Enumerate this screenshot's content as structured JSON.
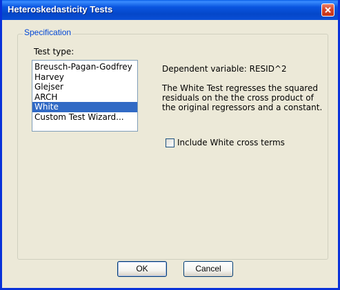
{
  "window": {
    "title": "Heteroskedasticity Tests",
    "close_icon": "close-icon"
  },
  "specification": {
    "group_label": "Specification",
    "test_type_label": "Test type:",
    "test_types": [
      "Breusch-Pagan-Godfrey",
      "Harvey",
      "Glejser",
      "ARCH",
      "White",
      "Custom Test Wizard..."
    ],
    "selected_test_type": "White",
    "dependent_variable": "Dependent variable: RESID^2",
    "description_lines": [
      "The White Test regresses the squared",
      "residuals on the the cross product of",
      "the original regressors and a constant."
    ],
    "cross_terms_label": "Include White cross terms",
    "cross_terms_checked": false
  },
  "buttons": {
    "ok_label": "OK",
    "cancel_label": "Cancel"
  },
  "colors": {
    "titlebar": "#0a55e0",
    "selection": "#316ac5",
    "group_label": "#0046d5",
    "dialog_bg": "#ece9d8"
  }
}
